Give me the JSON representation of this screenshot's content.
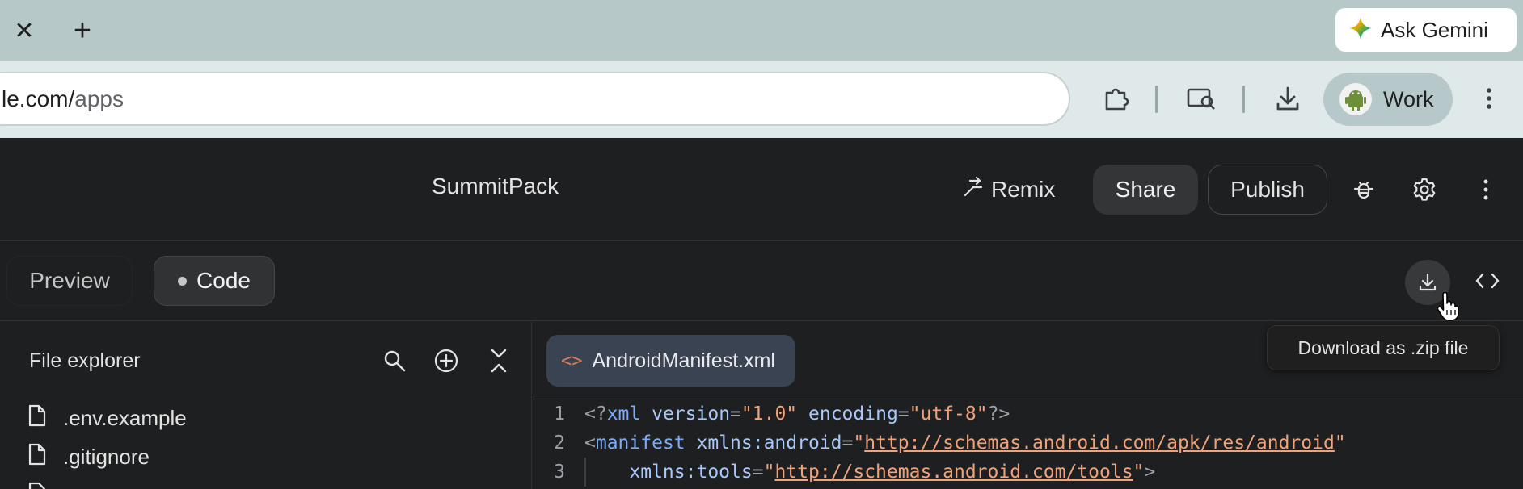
{
  "browser": {
    "close_tab_glyph": "✕",
    "new_tab_glyph": "+",
    "ask_gemini_label": "Ask Gemini",
    "url_host": "le.com/",
    "url_path": "apps",
    "profile_label": "Work"
  },
  "header": {
    "app_title": "SummitPack",
    "remix_label": "Remix",
    "share_label": "Share",
    "publish_label": "Publish"
  },
  "modes": {
    "preview_label": "Preview",
    "code_label": "Code",
    "download_tooltip": "Download as .zip file"
  },
  "explorer": {
    "title": "File explorer",
    "files": [
      {
        "name": ".env.example",
        "icon": "file-icon"
      },
      {
        "name": ".gitignore",
        "icon": "file-icon"
      }
    ]
  },
  "editor": {
    "open_tab": "AndroidManifest.xml",
    "tab_glyph": "<>",
    "lines": [
      {
        "num": "1"
      },
      {
        "num": "2"
      },
      {
        "num": "3"
      }
    ]
  },
  "colors": {
    "accent_tag": "#7cacf8",
    "string": "#f0a27a",
    "chrome_bg": "#b7c8c9",
    "app_bg": "#1e1f20"
  }
}
